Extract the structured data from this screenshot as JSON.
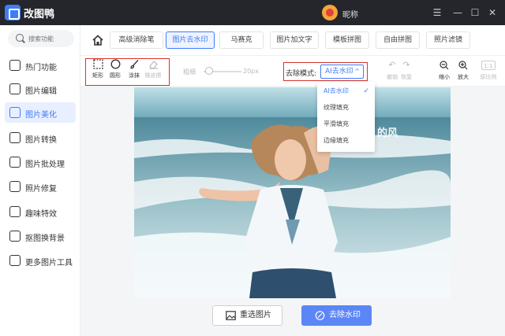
{
  "app": {
    "title": "改图鸭",
    "user_nickname": "昵称"
  },
  "sidebar": {
    "search_placeholder": "搜索功能",
    "items": [
      {
        "label": "热门功能",
        "icon": "fire-icon"
      },
      {
        "label": "图片编辑",
        "icon": "image-edit-icon"
      },
      {
        "label": "图片美化",
        "icon": "image-beautify-icon",
        "active": true
      },
      {
        "label": "图片转换",
        "icon": "convert-icon"
      },
      {
        "label": "图片批处理",
        "icon": "batch-icon"
      },
      {
        "label": "照片修复",
        "icon": "photo-repair-icon"
      },
      {
        "label": "趣味特效",
        "icon": "sparkle-icon"
      },
      {
        "label": "抠图换背景",
        "icon": "cutout-icon"
      },
      {
        "label": "更多图片工具",
        "icon": "toolbox-icon"
      }
    ]
  },
  "tabs": {
    "items": [
      "高级消除笔",
      "图片去水印",
      "马赛克",
      "图片加文字",
      "模板拼图",
      "自由拼图",
      "照片滤镜"
    ],
    "active_index": 1
  },
  "toolbar": {
    "tools": [
      {
        "label": "矩形",
        "icon": "rectangle-select-icon"
      },
      {
        "label": "圆形",
        "icon": "circle-select-icon"
      },
      {
        "label": "涂抹",
        "icon": "brush-icon"
      },
      {
        "label": "橡皮擦",
        "icon": "eraser-icon",
        "disabled": true
      }
    ],
    "thickness_label": "粗细",
    "thickness_value": "20px",
    "mode_label": "去除模式:",
    "mode_value": "AI去水印",
    "right_tools": [
      {
        "label": "撤销",
        "icon": "undo-icon",
        "enabled": false
      },
      {
        "label": "恢复",
        "icon": "redo-icon",
        "enabled": false
      },
      {
        "label": "缩小",
        "icon": "zoom-out-icon",
        "enabled": true
      },
      {
        "label": "放大",
        "icon": "zoom-in-icon",
        "enabled": true
      },
      {
        "label": "原比例",
        "icon": "ratio-icon",
        "enabled": false,
        "badge": "1:1"
      }
    ]
  },
  "mode_dropdown": {
    "options": [
      "AI去水印",
      "纹理填充",
      "平滑填充",
      "边缘填充"
    ],
    "selected_index": 0
  },
  "canvas": {
    "watermark_text": "的风"
  },
  "buttons": {
    "reselect": "重选图片",
    "remove_watermark": "去除水印"
  },
  "colors": {
    "accent": "#3f7cf8",
    "titlebar": "#25262b",
    "highlight_box": "#d9342b",
    "primary_button": "#5b86f6"
  }
}
